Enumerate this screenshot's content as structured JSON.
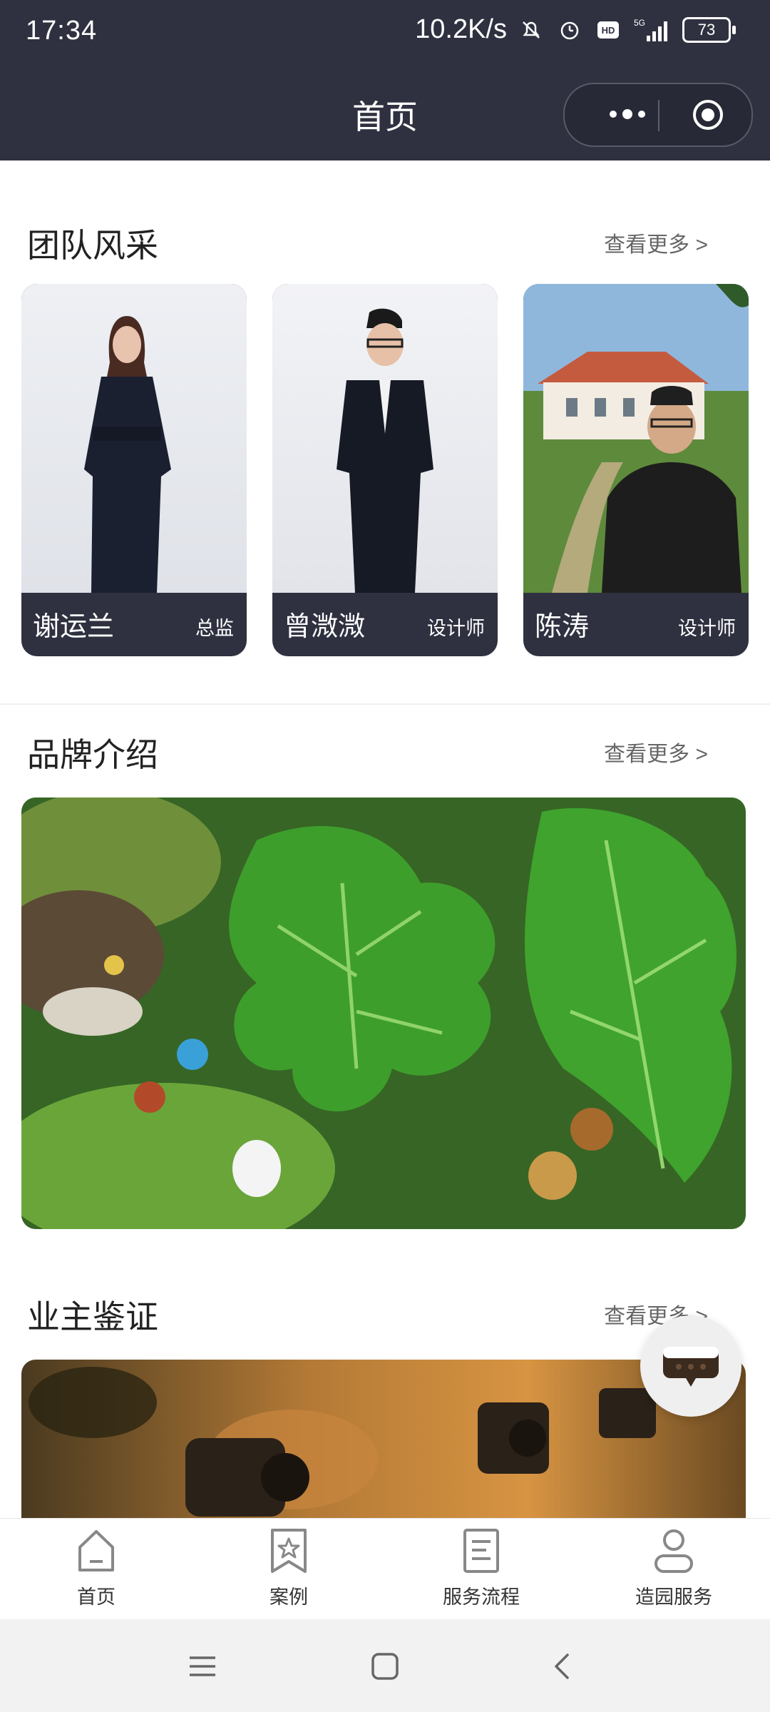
{
  "status_bar": {
    "time": "17:34",
    "network_speed": "10.2K/s",
    "battery": "73",
    "icons": [
      "mute-bell-icon",
      "alarm-icon",
      "hd-icon",
      "5g-signal-icon",
      "battery-icon"
    ]
  },
  "header": {
    "title": "首页",
    "capsule": {
      "more_icon": "more-dots-icon",
      "close_icon": "target-circle-icon"
    }
  },
  "team": {
    "title": "团队风采",
    "more": "查看更多 >",
    "members": [
      {
        "name": "谢运兰",
        "role": "总监"
      },
      {
        "name": "曾溦溦",
        "role": "设计师"
      },
      {
        "name": "陈涛",
        "role": "设计师"
      }
    ]
  },
  "brand": {
    "title": "品牌介绍",
    "more": "查看更多 >"
  },
  "owners": {
    "title": "业主鉴证",
    "more": "查看更多 >"
  },
  "fab": {
    "icon": "chat-bubble-icon"
  },
  "tabbar": {
    "items": [
      {
        "label": "首页",
        "icon": "home-icon"
      },
      {
        "label": "案例",
        "icon": "star-bookmark-icon"
      },
      {
        "label": "服务流程",
        "icon": "document-icon"
      },
      {
        "label": "造园服务",
        "icon": "user-icon"
      }
    ]
  },
  "colors": {
    "header_bg": "#2f3140",
    "card_caption_bg": "#2f3140",
    "text_primary": "#222222"
  }
}
